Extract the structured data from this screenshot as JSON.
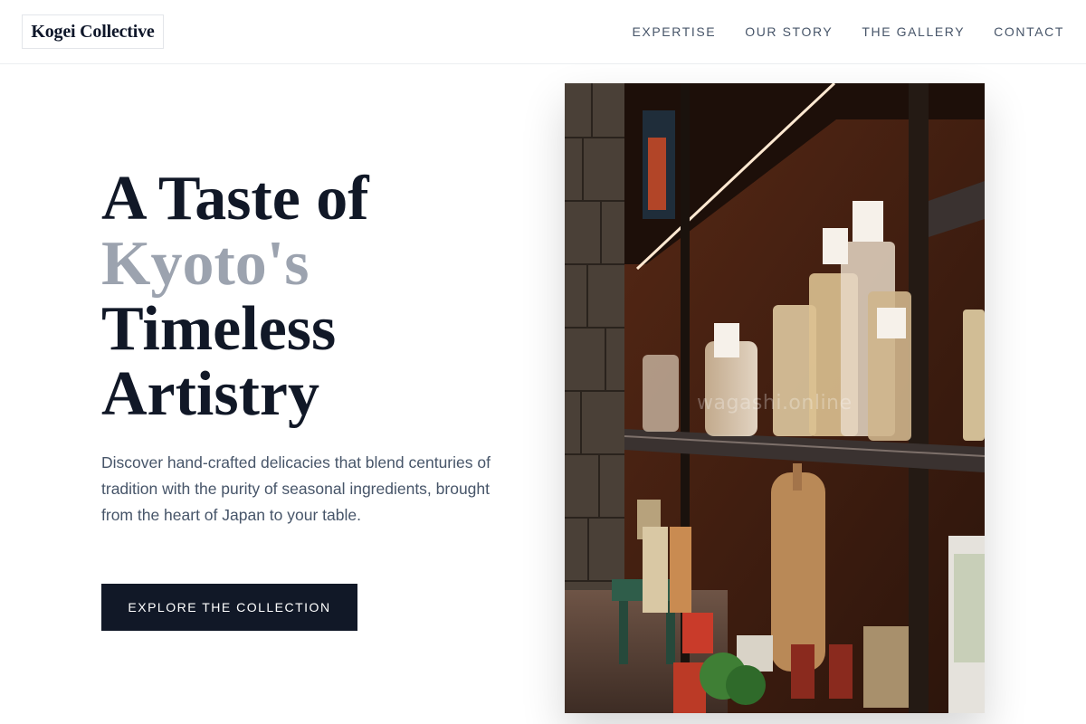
{
  "header": {
    "logo": "Kogei Collective",
    "nav": [
      {
        "label": "EXPERTISE"
      },
      {
        "label": "OUR STORY"
      },
      {
        "label": "THE GALLERY"
      },
      {
        "label": "CONTACT"
      }
    ]
  },
  "hero": {
    "title_line1": "A Taste of",
    "title_accent": "Kyoto's",
    "title_line3": "Timeless",
    "title_line4": "Artistry",
    "description": "Discover hand-crafted delicacies that blend centuries of tradition with the purity of seasonal ingredients, brought from the heart of Japan to your table.",
    "cta_label": "EXPLORE THE COLLECTION",
    "image_watermark": "wagashi.online"
  },
  "colors": {
    "primary_dark": "#111827",
    "accent_grey": "#9ca3af",
    "body_text": "#475569"
  }
}
